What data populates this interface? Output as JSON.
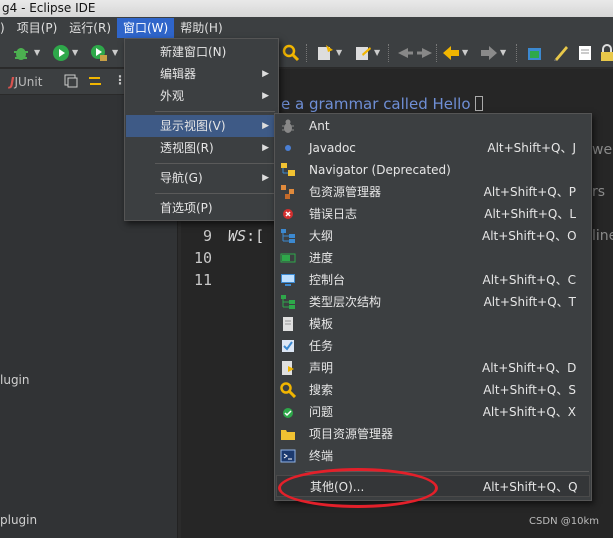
{
  "window": {
    "title": "g4 - Eclipse IDE"
  },
  "menubar": {
    "items": [
      {
        "label": ")",
        "active": false
      },
      {
        "label": "项目(P)",
        "active": false
      },
      {
        "label": "运行(R)",
        "active": false
      },
      {
        "label": "窗口(W)",
        "active": true
      },
      {
        "label": "帮助(H)",
        "active": false
      }
    ]
  },
  "left_panel": {
    "junit_label": "JUnit",
    "items": [
      "lugin",
      "plugin"
    ]
  },
  "editor": {
    "comment_top": "e a grammar called Hello",
    "right_fragments": [
      "we",
      "rs",
      "line"
    ],
    "lines": [
      {
        "number": "9",
        "text_italic": "WS",
        "text_rest": ":["
      },
      {
        "number": "10",
        "text_italic": "",
        "text_rest": ""
      },
      {
        "number": "11",
        "text_italic": "",
        "text_rest": ""
      }
    ]
  },
  "window_menu": {
    "items": [
      {
        "label": "新建窗口(N)",
        "submenu": false
      },
      {
        "label": "编辑器",
        "submenu": true
      },
      {
        "label": "外观",
        "submenu": true
      },
      {
        "label": "显示视图(V)",
        "submenu": true,
        "highlighted": true
      },
      {
        "label": "透视图(R)",
        "submenu": true
      },
      {
        "label": "导航(G)",
        "submenu": true
      },
      {
        "label": "首选项(P)",
        "submenu": false
      }
    ]
  },
  "show_view_menu": {
    "items": [
      {
        "label": "Ant",
        "shortcut": "",
        "icon": "ant-icon"
      },
      {
        "label": "Javadoc",
        "shortcut": "Alt+Shift+Q、J",
        "icon": "javadoc-icon"
      },
      {
        "label": "Navigator (Deprecated)",
        "shortcut": "",
        "icon": "navigator-icon"
      },
      {
        "label": "包资源管理器",
        "shortcut": "Alt+Shift+Q、P",
        "icon": "package-explorer-icon"
      },
      {
        "label": "错误日志",
        "shortcut": "Alt+Shift+Q、L",
        "icon": "error-log-icon"
      },
      {
        "label": "大纲",
        "shortcut": "Alt+Shift+Q、O",
        "icon": "outline-icon"
      },
      {
        "label": "进度",
        "shortcut": "",
        "icon": "progress-icon"
      },
      {
        "label": "控制台",
        "shortcut": "Alt+Shift+Q、C",
        "icon": "console-icon"
      },
      {
        "label": "类型层次结构",
        "shortcut": "Alt+Shift+Q、T",
        "icon": "type-hierarchy-icon"
      },
      {
        "label": "模板",
        "shortcut": "",
        "icon": "templates-icon"
      },
      {
        "label": "任务",
        "shortcut": "",
        "icon": "tasks-icon"
      },
      {
        "label": "声明",
        "shortcut": "Alt+Shift+Q、D",
        "icon": "declaration-icon"
      },
      {
        "label": "搜索",
        "shortcut": "Alt+Shift+Q、S",
        "icon": "search-icon"
      },
      {
        "label": "问题",
        "shortcut": "Alt+Shift+Q、X",
        "icon": "problems-icon"
      },
      {
        "label": "项目资源管理器",
        "shortcut": "",
        "icon": "project-explorer-icon"
      },
      {
        "label": "终端",
        "shortcut": "",
        "icon": "terminal-icon"
      }
    ],
    "other": {
      "label": "其他(O)...",
      "shortcut": "Alt+Shift+Q、Q"
    }
  },
  "watermark": "CSDN @10km",
  "colors": {
    "highlight": "#3e5a86",
    "annotation": "#e3202a",
    "menubar_active": "#2f65ca"
  }
}
